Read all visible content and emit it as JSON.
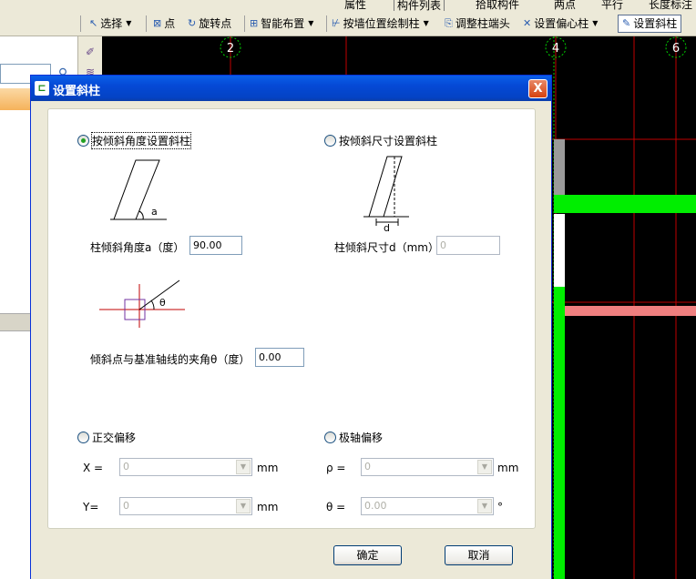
{
  "toolbar": {
    "top_partial": [
      "属性",
      "构件列表",
      "拾取构件",
      "两点",
      "平行",
      "长度标注"
    ],
    "items": [
      {
        "label": "选择",
        "icon": "cursor-icon",
        "dropdown": true
      },
      {
        "label": "点",
        "icon": "point-icon"
      },
      {
        "label": "旋转点",
        "icon": "rotate-icon"
      },
      {
        "label": "智能布置",
        "icon": "smart-layout-icon",
        "dropdown": true
      },
      {
        "label": "按墙位置绘制柱",
        "icon": "wall-column-icon",
        "dropdown": true
      },
      {
        "label": "调整柱端头",
        "icon": "column-end-icon"
      },
      {
        "label": "设置偏心柱",
        "icon": "eccentric-icon",
        "dropdown": true
      },
      {
        "label": "设置斜柱",
        "icon": "pencil-icon"
      }
    ]
  },
  "canvas": {
    "axis_labels": [
      "2",
      "4",
      "6"
    ]
  },
  "dialog": {
    "title": "设置斜柱",
    "close_glyph": "X",
    "by_angle": {
      "label": "按倾斜角度设置斜柱",
      "selected": true,
      "diagram_label": "a",
      "field_label": "柱倾斜角度a（度）",
      "field_value": "90.00"
    },
    "by_size": {
      "label": "按倾斜尺寸设置斜柱",
      "selected": false,
      "diagram_label": "d",
      "field_label": "柱倾斜尺寸d（mm）",
      "field_value": "0"
    },
    "theta": {
      "diagram_label": "θ",
      "field_label": "倾斜点与基准轴线的夹角θ（度）",
      "field_value": "0.00"
    },
    "ortho": {
      "label": "正交偏移",
      "x_label": "X =",
      "x_value": "0",
      "x_unit": "mm",
      "y_label": "Y=",
      "y_value": "0",
      "y_unit": "mm"
    },
    "polar": {
      "label": "极轴偏移",
      "rho_label": "ρ =",
      "rho_value": "0",
      "rho_unit": "mm",
      "theta_label": "θ =",
      "theta_value": "0.00",
      "theta_unit": "°"
    },
    "ok_label": "确定",
    "cancel_label": "取消"
  },
  "colors": {
    "accent_green": "#00ee00",
    "pink": "#f08080",
    "grid_red": "#c00000",
    "title_blue": "#0549d6"
  }
}
